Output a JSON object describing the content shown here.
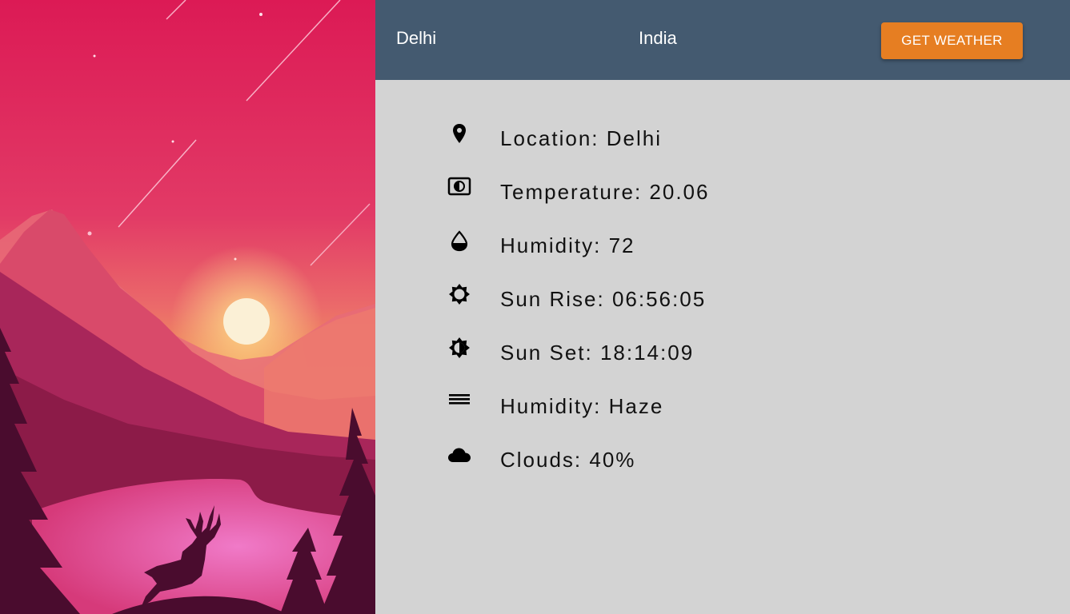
{
  "header": {
    "city_value": "Delhi",
    "country_value": "India",
    "button_label": "GET WEATHER"
  },
  "weather": [
    {
      "icon": "location-pin-icon",
      "text": "Location: Delhi"
    },
    {
      "icon": "thermometer-icon",
      "text": "Temperature: 20.06"
    },
    {
      "icon": "droplet-icon",
      "text": "Humidity: 72"
    },
    {
      "icon": "sunrise-icon",
      "text": "Sun Rise: 06:56:05"
    },
    {
      "icon": "sunset-icon",
      "text": "Sun Set: 18:14:09"
    },
    {
      "icon": "haze-icon",
      "text": "Humidity: Haze"
    },
    {
      "icon": "cloud-icon",
      "text": "Clouds: 40%"
    }
  ],
  "colors": {
    "header_bg": "#445a70",
    "button_bg": "#e67e22",
    "content_bg": "#d3d3d3"
  }
}
